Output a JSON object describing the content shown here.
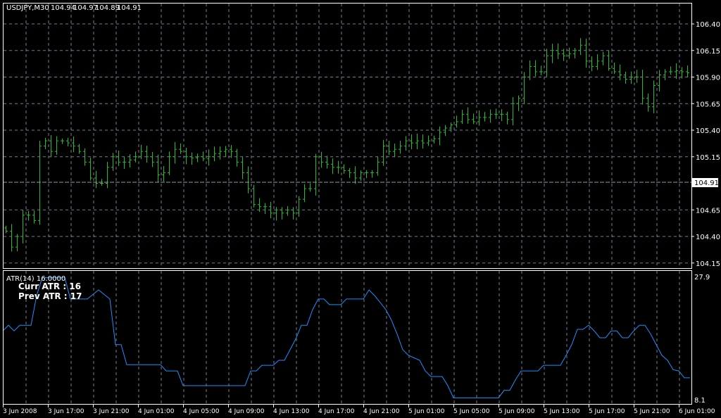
{
  "header": {
    "symbol": "USDJPY,M30",
    "open": "104.94",
    "high": "104.97",
    "low": "104.89",
    "close": "104.91"
  },
  "price_axis": {
    "ticks": [
      "106.40",
      "106.15",
      "105.90",
      "105.65",
      "105.40",
      "105.15",
      "104.65",
      "104.40",
      "104.15"
    ],
    "bid_label": "104.91",
    "bid_value": 104.91
  },
  "indicator": {
    "title": "ATR(14) 16.0000",
    "curr_label": "Curr ATR : 16",
    "prev_label": "Prev ATR : 17",
    "axis_max": "27.9",
    "axis_min": "8.1",
    "color": "#1e90ff"
  },
  "time_axis": [
    "3 Jun 2008",
    "3 Jun 17:00",
    "3 Jun 21:00",
    "4 Jun 01:00",
    "4 Jun 05:00",
    "4 Jun 09:00",
    "4 Jun 13:00",
    "4 Jun 17:00",
    "4 Jun 21:00",
    "5 Jun 01:00",
    "5 Jun 05:00",
    "5 Jun 09:00",
    "5 Jun 13:00",
    "5 Jun 17:00",
    "5 Jun 21:00",
    "6 Jun 01:00"
  ],
  "colors": {
    "bars": "#22c022",
    "grid": "#6f7f8f",
    "axis": "#ffffff"
  },
  "chart_data": {
    "type": "line",
    "price_closes": [
      104.45,
      104.3,
      104.4,
      104.6,
      104.6,
      104.55,
      105.25,
      105.3,
      105.2,
      105.3,
      105.3,
      105.28,
      105.25,
      105.2,
      105.1,
      104.95,
      104.9,
      104.9,
      105.05,
      105.15,
      105.1,
      105.1,
      105.12,
      105.15,
      105.2,
      105.15,
      105.1,
      104.98,
      105.0,
      105.15,
      105.22,
      105.2,
      105.15,
      105.14,
      105.15,
      105.13,
      105.15,
      105.18,
      105.2,
      105.22,
      105.2,
      105.1,
      105.0,
      104.85,
      104.7,
      104.68,
      104.68,
      104.62,
      104.65,
      104.62,
      104.65,
      104.62,
      104.75,
      104.85,
      104.85,
      105.15,
      105.1,
      105.08,
      105.05,
      105.05,
      105.02,
      105.0,
      104.95,
      105.0,
      105.0,
      105.0,
      105.1,
      105.25,
      105.2,
      105.22,
      105.25,
      105.3,
      105.28,
      105.3,
      105.28,
      105.3,
      105.32,
      105.38,
      105.42,
      105.45,
      105.48,
      105.55,
      105.5,
      105.48,
      105.52,
      105.52,
      105.55,
      105.55,
      105.55,
      105.5,
      105.65,
      105.7,
      105.9,
      106.0,
      105.95,
      105.95,
      106.1,
      106.15,
      106.12,
      106.1,
      106.12,
      106.15,
      106.2,
      106.05,
      106.0,
      106.05,
      106.1,
      105.98,
      105.95,
      105.92,
      105.88,
      105.9,
      105.9,
      105.7,
      105.62,
      105.82,
      105.92,
      105.95,
      105.95,
      105.96,
      105.95,
      105.94
    ],
    "price_range": [
      104.1,
      106.5
    ],
    "atr_points": [
      [
        0,
        19.1
      ],
      [
        1,
        20.0
      ],
      [
        2,
        19.1
      ],
      [
        3,
        20.0
      ],
      [
        5,
        20.0
      ],
      [
        6,
        24.75
      ],
      [
        7,
        27.6
      ],
      [
        11,
        27.6
      ],
      [
        12,
        24.2
      ],
      [
        15,
        24.2
      ],
      [
        17,
        25.65
      ],
      [
        19,
        24.2
      ],
      [
        20,
        16.9
      ],
      [
        21,
        16.9
      ],
      [
        22,
        13.7
      ],
      [
        28,
        13.7
      ],
      [
        29,
        12.7
      ],
      [
        31,
        12.7
      ],
      [
        32,
        10.35
      ],
      [
        43,
        10.35
      ],
      [
        44,
        12.7
      ],
      [
        45,
        12.7
      ],
      [
        46,
        13.6
      ],
      [
        48,
        13.6
      ],
      [
        49,
        14.4
      ],
      [
        50,
        14.4
      ],
      [
        51,
        16.1
      ],
      [
        52,
        17.8
      ],
      [
        53,
        20.0
      ],
      [
        54,
        20.0
      ],
      [
        55,
        22.5
      ],
      [
        56,
        24.2
      ],
      [
        57,
        24.2
      ],
      [
        58,
        23.3
      ],
      [
        60,
        23.3
      ],
      [
        61,
        24.2
      ],
      [
        64,
        24.2
      ],
      [
        65,
        25.65
      ],
      [
        66,
        24.75
      ],
      [
        68,
        22.5
      ],
      [
        69,
        20.8
      ],
      [
        70,
        18.6
      ],
      [
        71,
        16.1
      ],
      [
        72,
        15.2
      ],
      [
        74,
        14.4
      ],
      [
        75,
        12.7
      ],
      [
        76,
        11.8
      ],
      [
        78,
        11.8
      ],
      [
        79,
        10.35
      ],
      [
        80,
        8.4
      ],
      [
        88,
        8.4
      ],
      [
        89,
        9.6
      ],
      [
        90,
        9.6
      ],
      [
        91,
        11.25
      ],
      [
        92,
        12.7
      ],
      [
        95,
        12.7
      ],
      [
        96,
        13.6
      ],
      [
        99,
        13.6
      ],
      [
        100,
        15.2
      ],
      [
        101,
        16.9
      ],
      [
        102,
        19.35
      ],
      [
        103,
        19.35
      ],
      [
        104,
        20.0
      ],
      [
        105,
        19.1
      ],
      [
        106,
        18.0
      ],
      [
        107,
        18.0
      ],
      [
        108,
        19.1
      ],
      [
        109,
        19.1
      ],
      [
        110,
        18.0
      ],
      [
        111,
        18.0
      ],
      [
        112,
        19.1
      ],
      [
        113,
        20.0
      ],
      [
        114,
        20.0
      ],
      [
        115,
        18.6
      ],
      [
        116,
        16.9
      ],
      [
        117,
        15.2
      ],
      [
        118,
        14.4
      ],
      [
        119,
        12.9
      ],
      [
        120,
        12.7
      ],
      [
        121,
        11.6
      ],
      [
        122,
        11.6
      ]
    ],
    "atr_range": [
      8.1,
      27.9
    ]
  }
}
